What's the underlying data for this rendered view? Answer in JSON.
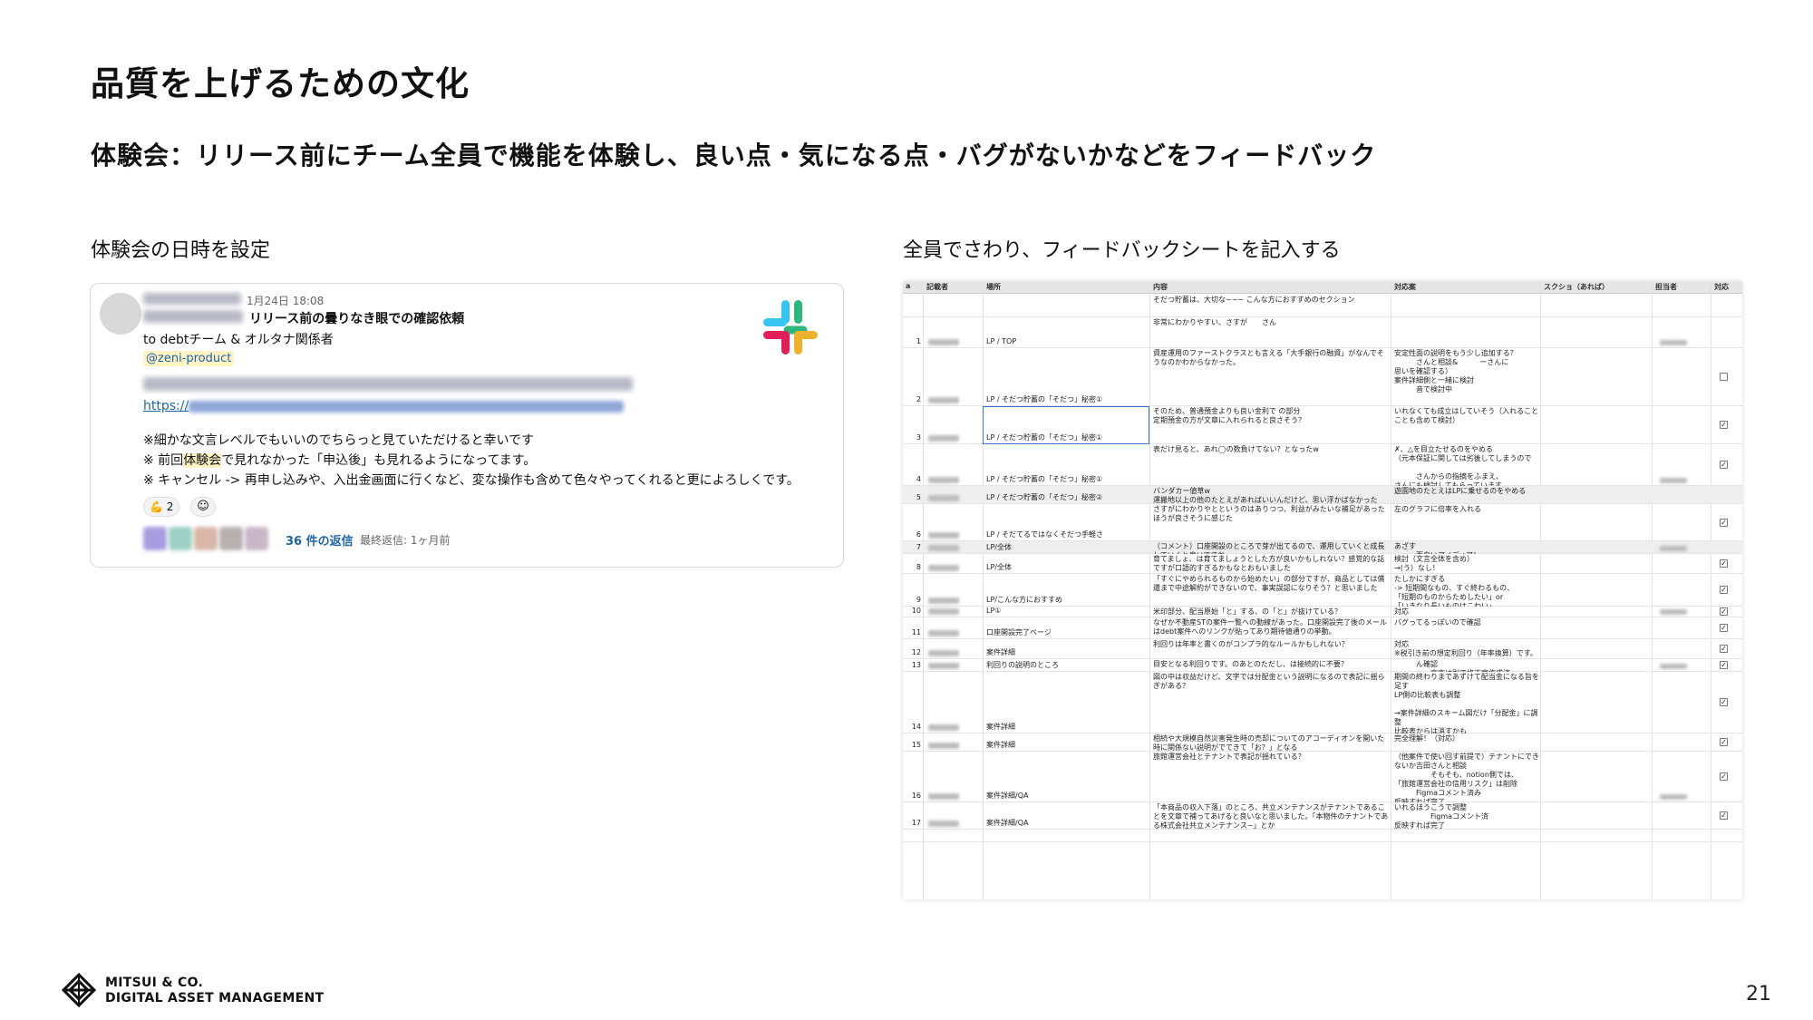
{
  "slide": {
    "title": "品質を上げるための文化",
    "subtitle": "体験会：リリース前にチーム全員で機能を体験し、良い点・気になる点・バグがないかなどをフィードバック",
    "left_heading": "体験会の日時を設定",
    "right_heading": "全員でさわり、フィードバックシートを記入する",
    "page_number": "21"
  },
  "slack_message": {
    "timestamp": "1月24日 18:08",
    "title": "リリース前の曇りなき眼での確認依頼",
    "to_line": "to debtチーム & オルタナ関係者",
    "mention": "@zeni-product",
    "link_text": "https://",
    "line1": "※細かな文言レベルでもいいのでちらっと見ていただけると幸いです",
    "line2_pre": "※ 前回",
    "line2_hl": "体験会",
    "line2_post": "で見れなかった「申込後」も見れるようになってます。",
    "line3": "※ キャンセル -> 再申し込みや、入出金画面に行くなど、変な操作も含めて色々やってくれると更によろしくです。",
    "reaction_emoji": "💪",
    "reaction_count": "2",
    "add_reaction_icon": "add-reaction-icon",
    "replies": "36 件の返信",
    "last_reply": "最終返信: 1ヶ月前"
  },
  "sheet": {
    "headers": [
      "a",
      "記載者",
      "場所",
      "内容",
      "対応案",
      "スクショ（あれば）",
      "担当者",
      "対応"
    ],
    "top_content": "そだつ貯蓄は、大切な~~~ こんな方におすすめのセクション",
    "rows": [
      {
        "no": "1",
        "place": "LP / TOP",
        "content": "非常にわかりやすい、さすが　　さん",
        "response": "",
        "check": "none"
      },
      {
        "no": "2",
        "place": "LP / そだつ貯蓄の「そだつ」秘密①",
        "content": "資産運用のファーストクラスとも言える「大手銀行の融資」がなんでそうなのかわからなかった。",
        "response": "安定性面の説明をもう少し追加する？\n　　　さんと相談&　　　ーさんに\n思いを確認する）\n案件詳細側と一緒に検討\n　　　音で検討中",
        "check": "empty"
      },
      {
        "no": "3",
        "place": "LP / そだつ貯蓄の「そだつ」秘密①",
        "content": "そのため、普通預金よりも良い金利で の部分\n定期預金の方が文章に入れられると良さそう？",
        "response": "いれなくても成立はしていそう（入れること\nことも含めて検討）",
        "check": "checked"
      },
      {
        "no": "4",
        "place": "LP / そだつ貯蓄の「そだつ」秘密①",
        "content": "表だけ見ると、あれ◯の数負けてない？となったw",
        "response": "✗、△を目立たせるのをやめる\n（元本保証に関しては劣後してしまうので\n\n　　　さんからの指摘をふまえ、\nさんにも検討してもらっています",
        "check": "checked"
      },
      {
        "no": "5",
        "place": "LP / そだつ貯蓄の「そだつ」秘密②",
        "content": "バンダカー値草w\n運搬地以上の他のたとえがあればいいんだけど、思い浮かばなかった",
        "response": "遊園地のたとえはLPに乗せるのをやめる",
        "check": "none"
      },
      {
        "no": "6",
        "place": "LP / そだてるではなくそだつ手軽さ",
        "content": "さすがにわかりやとというのはありつつ、利益がみたいな補足があったほうが良さそうに感じた",
        "response": "左のグラフに倍率を入れる",
        "check": "checked"
      },
      {
        "no": "7",
        "place": "LP/全体",
        "content": "（コメント）口座開設のところで芽が出てるので、運用していくと成長していくと良いですね",
        "response": "あざす\n　　　面白いアイディア！",
        "check": "none"
      },
      {
        "no": "8",
        "place": "LP/全体",
        "content": "育てましょ、は育てましょうとした方が良いかもしれない？感覚的な話ですが口語的すぎるかもなとおもいました",
        "response": "検討（文言全体を含め）\n→(う）なし！",
        "check": "checked"
      },
      {
        "no": "9",
        "place": "LP/こんな方におすすめ",
        "content": "「すぐにやめられるものから始めたい」の部分ですが、商品としては償還まで中途解約ができないので、事実誤認になりそう？と思いました",
        "response": "たしかにすぎる\n-> 短期間なもの、すぐ終わるもの、\n「短期のものからためしたい」or\n「いきなり長いものはこわい」",
        "check": "checked"
      },
      {
        "no": "10",
        "place": "LP①",
        "content": "米印部分、配当原始「と」する、の「と」が抜けている？",
        "response": "対応",
        "check": "checked"
      },
      {
        "no": "11",
        "place": "口座開設完了ページ",
        "content": "なぜか不動産STの案件一覧への動線があった。口座開設完了後のメールはdebt案件へのリンクが貼ってあり期待値通りの挙動。",
        "response": "バグってるっぽいので確認",
        "check": "checked"
      },
      {
        "no": "12",
        "place": "案件詳細",
        "content": "利回りは年率と書くのがコンプラ的なルールかもしれない？",
        "response": "対応\n※税引き前の想定利回り（年率換算）です。",
        "check": "checked"
      },
      {
        "no": "13",
        "place": "利回りの説明のところ",
        "content": "目安となる利回りです。のあとのただし、は接続的に不要？",
        "response": "　　　ん確認\n　　　　　文言は別で修正案作成済",
        "check": "checked"
      },
      {
        "no": "14",
        "place": "案件詳細",
        "content": "図の中は収益だけど、文字では分配金という説明になるので表記に揺らぎがある？",
        "response": "期間の終わりまであずけて配当金になる旨を足す\nLP側の比較表も調整\n\n→案件詳細のスキーム図だけ「分配金」に調整\n比較表からは消すかも",
        "check": "checked"
      },
      {
        "no": "15",
        "place": "案件詳細",
        "content": "相続や大規模自然災害発生時の売却についてのアコーディオンを開いた時に関係ない説明がでてきて「お？」となる",
        "response": "完全理解！（対応）",
        "check": "checked"
      },
      {
        "no": "16",
        "place": "案件詳細/QA",
        "content": "旅館運営会社とテナントで表記が揺れている？",
        "response": "（他案件で使い回す前提で）テナントにできないか吉田さんと相談\n　　　　　そもそも、notion側では、\n「旅館運営会社の信用リスク」は削除\n　　　Figmaコメント済み\n反映すれば完了",
        "check": "checked"
      },
      {
        "no": "17",
        "place": "案件詳細/QA",
        "content": "「本商品の収入下落」のところ、共立メンテナンスがテナントであることを文章で補ってあげると良いなと思いました。「本物件のテナントである株式会社共立メンテナンス~」とか",
        "response": "いれるほうこうで調整\n　　　　　Figmaコメント済\n反映すれば完了",
        "check": "checked"
      }
    ]
  },
  "footer": {
    "company_line1": "MITSUI & CO.",
    "company_line2": "DIGITAL ASSET MANAGEMENT"
  }
}
